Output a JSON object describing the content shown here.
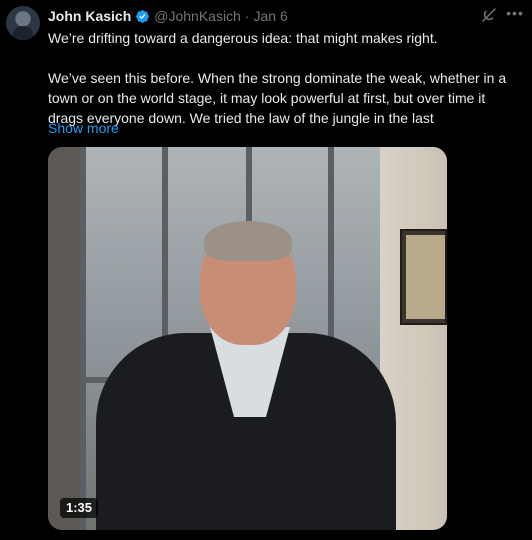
{
  "author": {
    "name": "John Kasich",
    "handle": "@JohnKasich",
    "separator": "·",
    "date": "Jan 6",
    "verified_icon": "verified-badge-icon"
  },
  "tweet": {
    "paragraph1": "We’re drifting toward a dangerous idea: that might makes right.",
    "paragraph2": "We’ve seen this before. When the strong dominate the weak, whether in a town or on the world stage, it may look powerful at first, but over time it drags everyone down. We tried the law of the jungle in the last",
    "show_more": "Show more"
  },
  "video": {
    "duration": "1:35"
  },
  "icons": {
    "grok": "grok-icon",
    "more": "more-options-icon"
  },
  "colors": {
    "background": "#000000",
    "text": "#e7e9ea",
    "secondary": "#71767b",
    "link": "#1d9bf0",
    "verified": "#1d9bf0"
  }
}
